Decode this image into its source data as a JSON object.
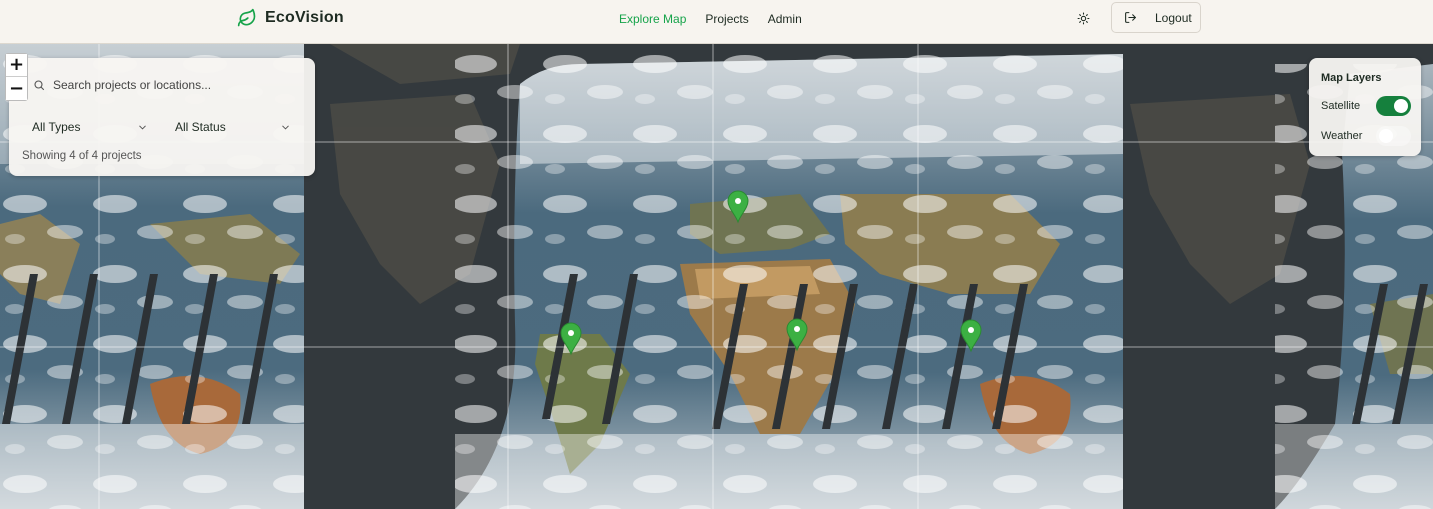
{
  "header": {
    "brand": "EcoVision",
    "nav": [
      {
        "label": "Explore Map",
        "active": true
      },
      {
        "label": "Projects",
        "active": false
      },
      {
        "label": "Admin",
        "active": false
      }
    ],
    "theme_icon": "sun-icon",
    "logout_label": "Logout",
    "logout_icon": "logout-icon"
  },
  "map": {
    "zoom_in_label": "+",
    "zoom_out_label": "−",
    "base_layer": "satellite",
    "marker_color": "#3cb043",
    "markers": [
      "marker-europe",
      "marker-south-america",
      "marker-east-africa",
      "marker-southeast-asia"
    ]
  },
  "search": {
    "placeholder": "Search projects or locations...",
    "type_filter": "All Types",
    "status_filter": "All Status",
    "count_text": "Showing 4 of 4 projects"
  },
  "layers": {
    "title": "Map Layers",
    "items": [
      {
        "label": "Satellite",
        "enabled": true
      },
      {
        "label": "Weather",
        "enabled": false
      }
    ]
  },
  "colors": {
    "accent": "#16a34a",
    "toggle_on": "#15803d",
    "header_bg": "#f7f4ef",
    "map_bg": "#33393d"
  }
}
